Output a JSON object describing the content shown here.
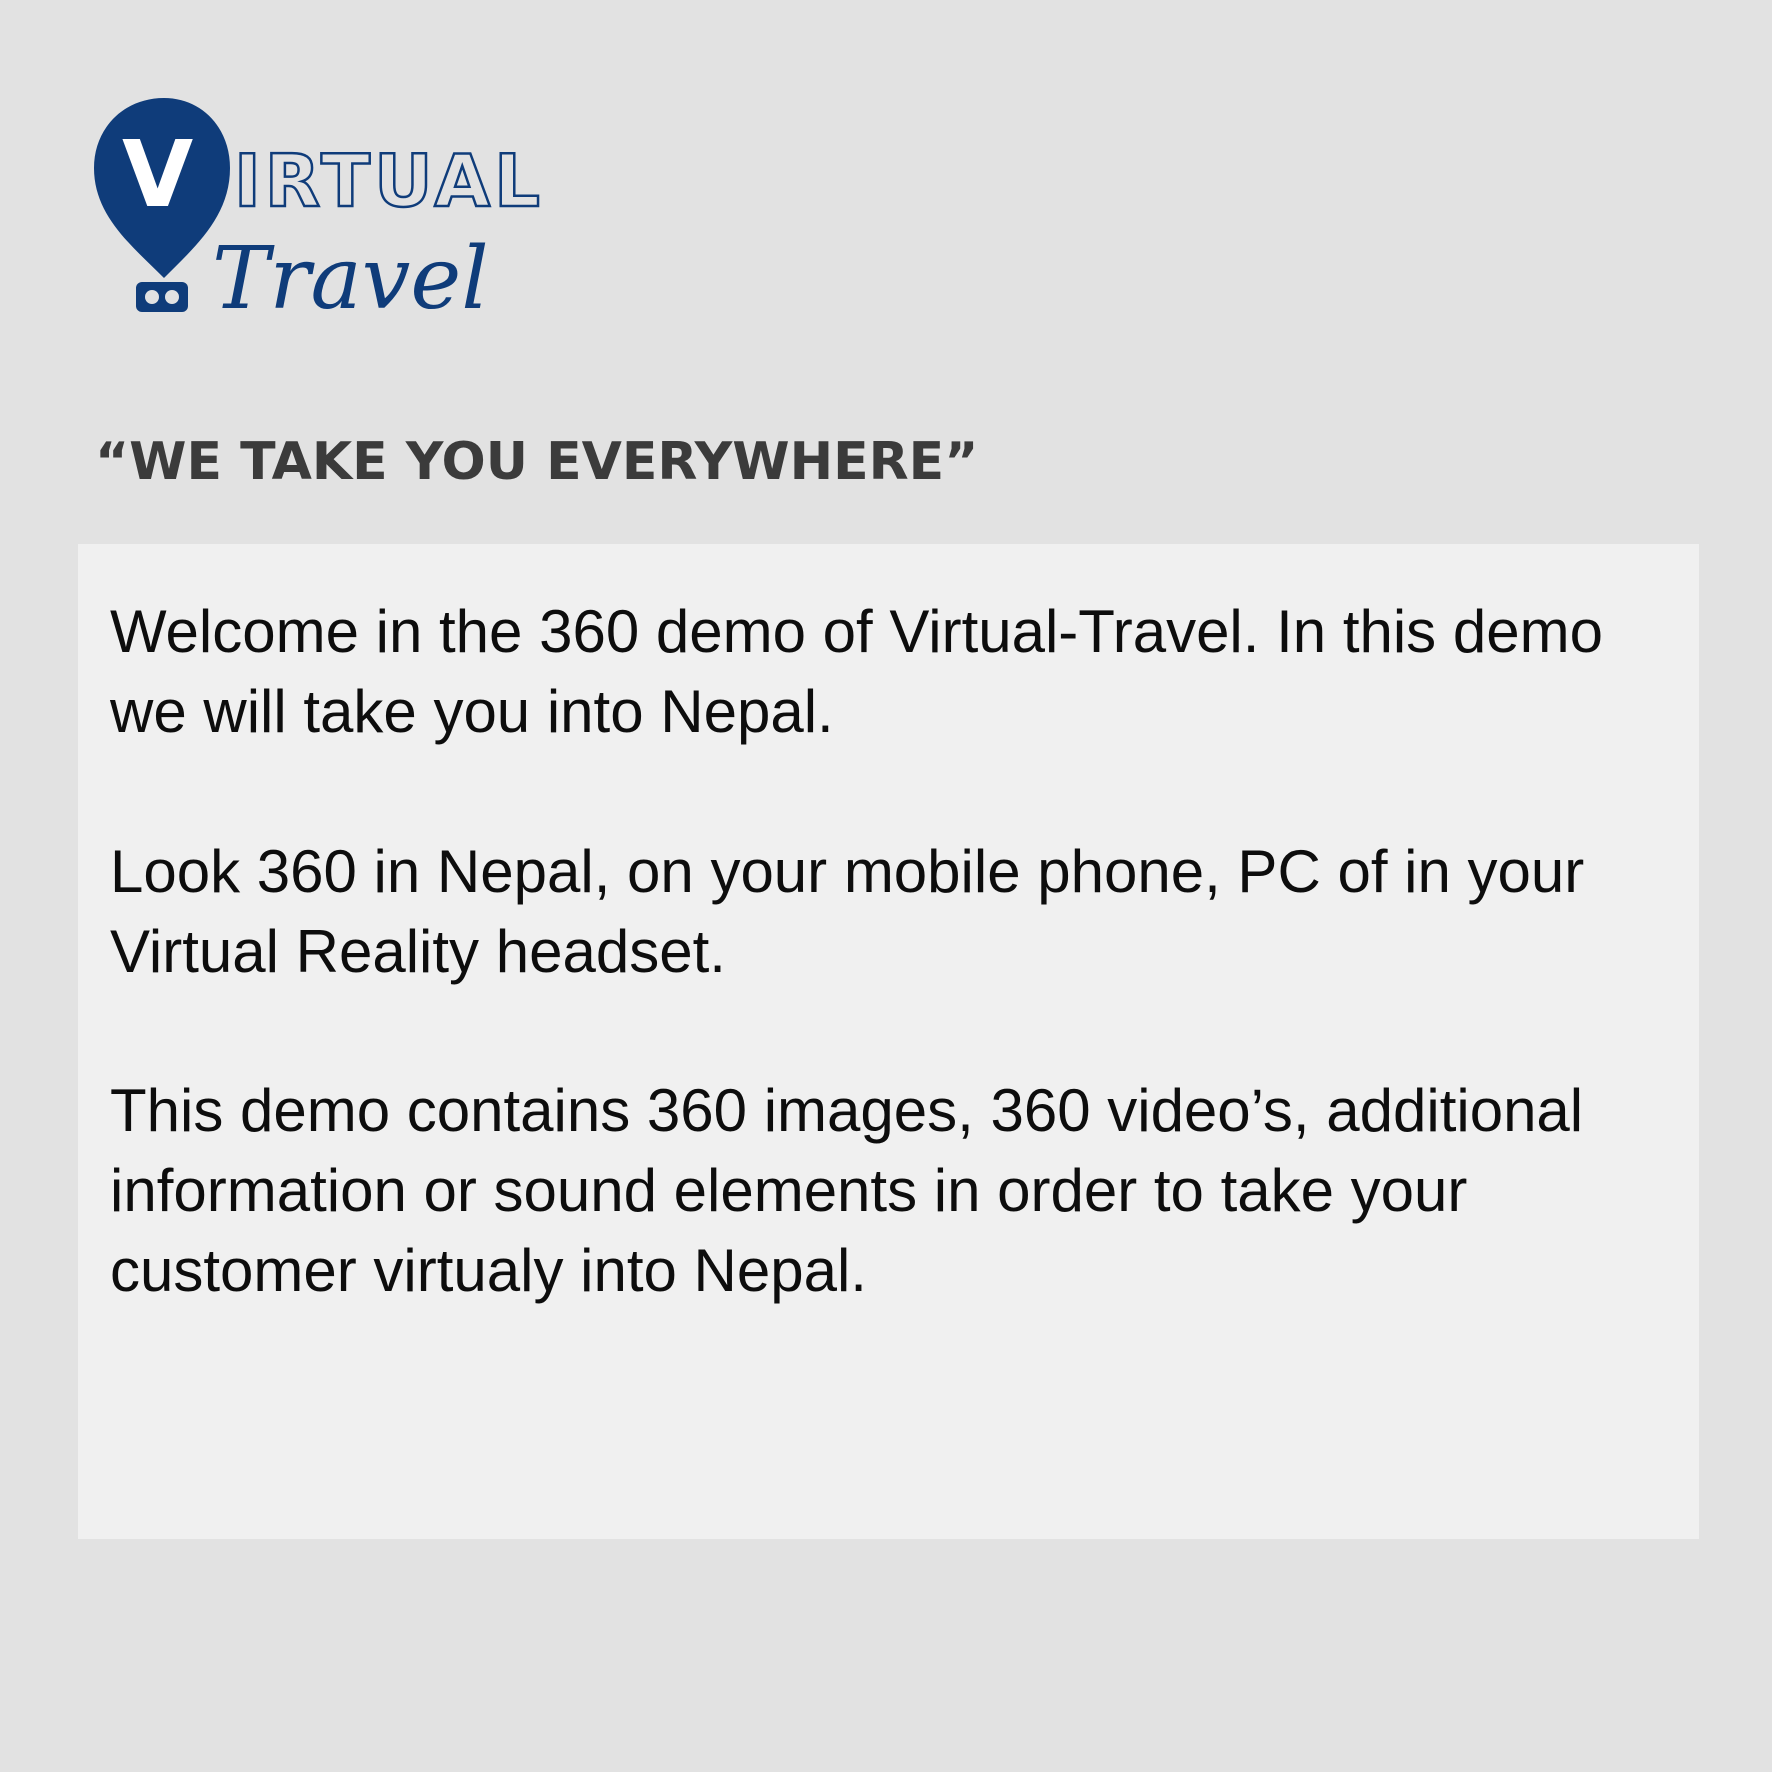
{
  "brand": {
    "logo_line1": "IRTUAL",
    "logo_initial": "V",
    "logo_line2": "Travel",
    "color_primary": "#0f3c7a"
  },
  "tagline": "“WE TAKE YOU EVERYWHERE”",
  "content": {
    "paragraphs": [
      "Welcome in the 360 demo of Virtual-Travel. In this demo we will take you into Nepal.",
      "Look 360 in Nepal, on your mobile phone, PC of in your Virtual Reality headset.",
      "This demo contains 360 images, 360 video’s, additional information or sound elements in order to take your customer virtualy into Nepal."
    ]
  }
}
